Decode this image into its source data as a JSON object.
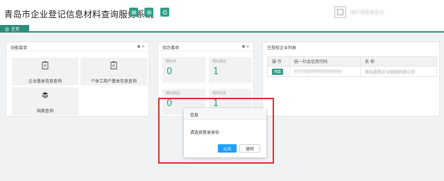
{
  "header": {
    "app_title": "青岛市企业登记信息材料查询服务系统",
    "user_name": "用户名称未显示"
  },
  "tabs": [
    {
      "label": "主页"
    }
  ],
  "menu_panel": {
    "title": "功能菜单",
    "items": [
      {
        "label": "企业基本信息查询",
        "icon": "document-icon"
      },
      {
        "label": "个体工商户基本信息查询",
        "icon": "document-icon"
      },
      {
        "label": "档案查询",
        "icon": "layers-icon"
      }
    ]
  },
  "todo_panel": {
    "title": "待办事项",
    "stats": [
      {
        "label": "预约中",
        "value": "0"
      },
      {
        "label": "预约通过",
        "value": "1"
      },
      {
        "label": "预约驳回",
        "value": "0"
      },
      {
        "label": "预约历史",
        "value": "1"
      }
    ]
  },
  "company_panel": {
    "title": "已授权企业列表",
    "columns": [
      "操 作",
      "统一社会信用代码",
      "名 称"
    ],
    "rows": [
      {
        "action": "档案",
        "code": "9137020000000000XX",
        "name": "青岛某某企业管理有限公司"
      }
    ]
  },
  "dialog": {
    "title": "信息",
    "message": "请选择登录身份",
    "primary_button": "公众",
    "secondary_button": "律师"
  },
  "colors": {
    "brand": "#2f9e86",
    "accent_blue": "#1e9fff",
    "highlight_red": "#e02b2b"
  }
}
